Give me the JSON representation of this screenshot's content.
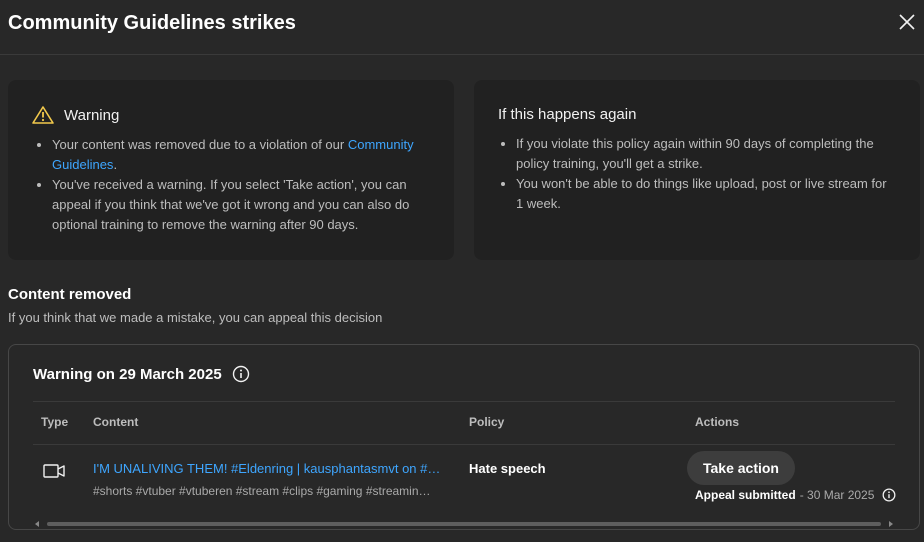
{
  "dialog": {
    "title": "Community Guidelines strikes",
    "close_icon": "close-icon"
  },
  "warning_card": {
    "title": "Warning",
    "icon": "warning-icon",
    "bullet1_text": "Your content was removed due to a violation of our ",
    "bullet1_link": "Community Guidelines",
    "bullet1_end": ".",
    "bullet2_text": "You've received a warning. If you select 'Take action', you can appeal if you think that we've got it wrong and you can also do optional training to remove the warning after 90 days."
  },
  "again_card": {
    "title": "If this happens again",
    "bullets": [
      "If you violate this policy again within 90 days of completing the policy training, you'll get a strike.",
      "You won't be able to do things like upload, post or live stream for 1 week."
    ]
  },
  "content_removed": {
    "title": "Content removed",
    "subtitle": "If you think that we made a mistake, you can appeal this decision"
  },
  "strike_panel": {
    "title": "Warning on 29 March 2025",
    "columns": [
      "Type",
      "Content",
      "Policy",
      "Actions"
    ],
    "row": {
      "type_icon": "video-icon",
      "content_title": "I'M UNALIVING THEM! #Eldenring | kausphantasmvt on #T…",
      "content_tags": "#shorts #vtuber #vtuberen #stream #clips #gaming #streamin…",
      "policy": "Hate speech",
      "action_button": "Take action",
      "appeal_status": "Appeal submitted",
      "appeal_date": " - 30 Mar 2025"
    }
  },
  "colors": {
    "background": "#282828",
    "card": "#212121",
    "link": "#3ea6ff",
    "warning": "#f2c94c"
  }
}
